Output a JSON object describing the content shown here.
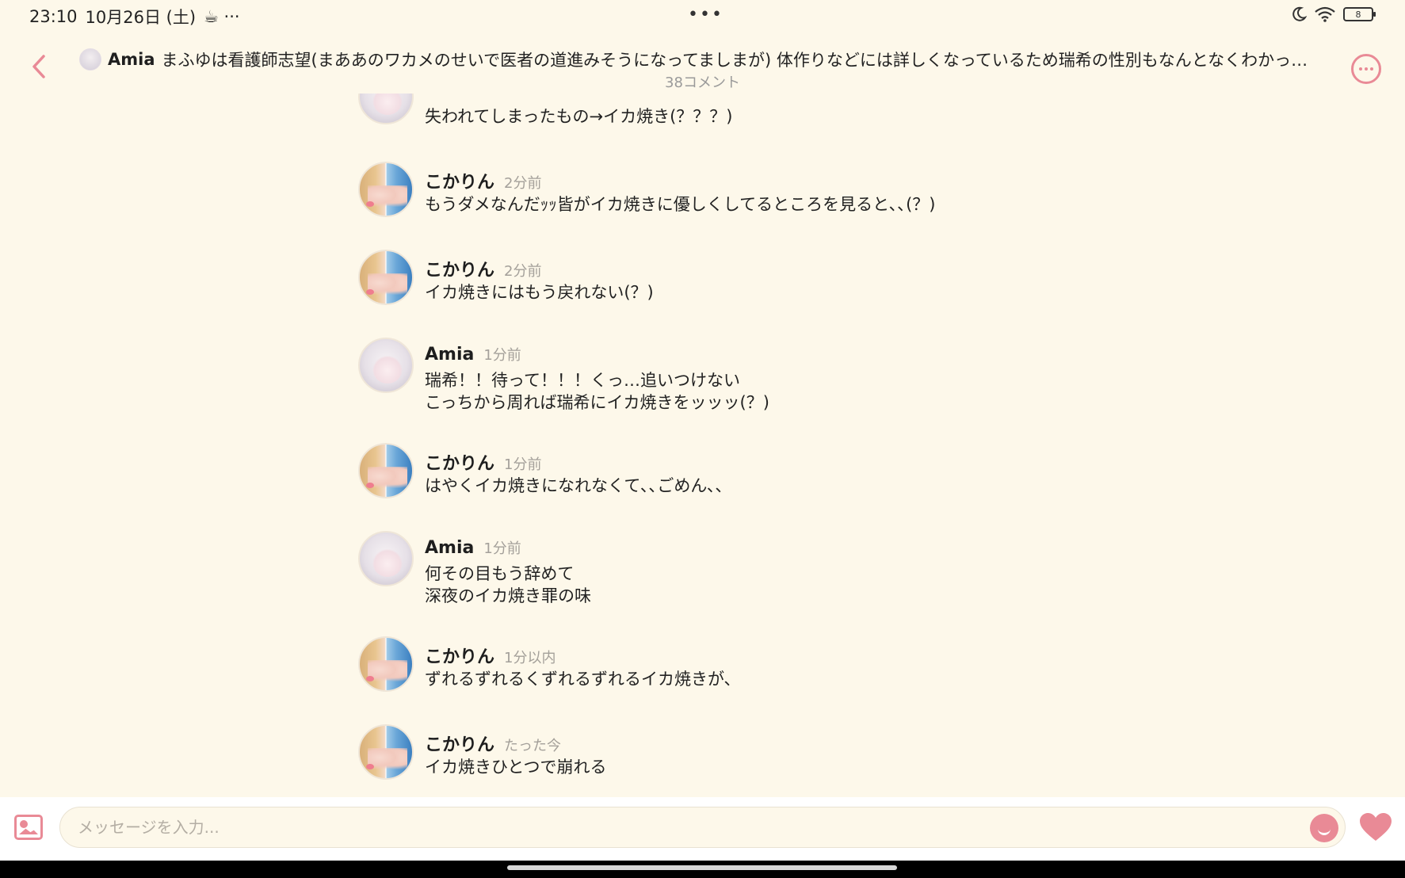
{
  "status_bar": {
    "time": "23:10",
    "date": "10月26日 (土)",
    "extra": "☕ ···",
    "center_dots": "•••",
    "battery": "8"
  },
  "header": {
    "author": "Amia",
    "title": "まふゆは看護師志望(まああのワカメのせいで医者の道進みそうになってましまが) 体作りなどには詳しくなっているため瑞希の性別もなんとなくわかっ…",
    "comment_count": "38コメント"
  },
  "messages": [
    {
      "author": "",
      "time": "",
      "text": "失われてしまったもの→イカ焼き(？？？)",
      "avatar": "amia"
    },
    {
      "author": "こかりん",
      "time": "2分前",
      "text": "もうダメなんだｯｯ皆がイカ焼きに優しくしてるところを見ると､､(？)",
      "avatar": "kori"
    },
    {
      "author": "こかりん",
      "time": "2分前",
      "text": "イカ焼きにはもう戻れない(？)",
      "avatar": "kori"
    },
    {
      "author": "Amia",
      "time": "1分前",
      "text": "瑞希！！待って！！！くっ…追いつけない\nこっちから周れば瑞希にイカ焼きをッッッ(？)",
      "avatar": "amia"
    },
    {
      "author": "こかりん",
      "time": "1分前",
      "text": "はやくイカ焼きになれなくて､､ごめん､､",
      "avatar": "kori"
    },
    {
      "author": "Amia",
      "time": "1分前",
      "text": "何その目もう辞めて\n深夜のイカ焼き罪の味",
      "avatar": "amia"
    },
    {
      "author": "こかりん",
      "time": "1分以内",
      "text": "ずれるずれるくずれるずれるイカ焼きが､",
      "avatar": "kori"
    },
    {
      "author": "こかりん",
      "time": "たった今",
      "text": "イカ焼きひとつで崩れる",
      "avatar": "kori"
    }
  ],
  "composer": {
    "placeholder": "メッセージを入力..."
  },
  "colors": {
    "background": "#fdf8ea",
    "accent": "#e98a96"
  }
}
